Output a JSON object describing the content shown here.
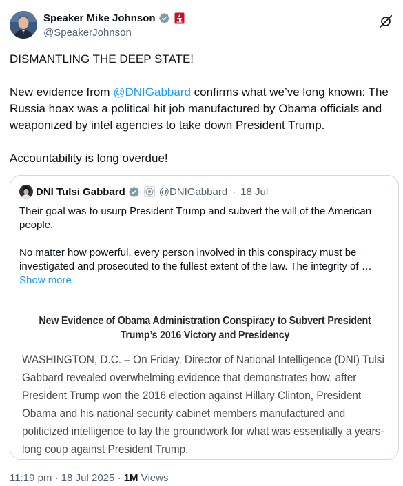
{
  "author": {
    "name": "Speaker Mike Johnson",
    "handle": "@SpeakerJohnson"
  },
  "tweet": {
    "line1": "DISMANTLING THE DEEP STATE!",
    "para2_before": "New evidence from ",
    "para2_mention": "@DNIGabbard",
    "para2_after": " confirms what we’ve long known: The Russia hoax was a political hit job manufactured by Obama officials and weaponized by intel agencies to take down President Trump.",
    "para3": "Accountability is long overdue!"
  },
  "quote": {
    "name": "DNI Tulsi Gabbard",
    "handle": "@DNIGabbard",
    "separator": "·",
    "date": "18 Jul",
    "para1": "Their goal was to usurp President Trump and subvert the will of the American people.",
    "para2": "No matter how powerful, every person involved in this conspiracy must be investigated and prosecuted to the fullest extent of the law. The integrity of …",
    "show_more": "Show more",
    "image": {
      "title": "New Evidence of Obama Administration Conspiracy to Subvert President Trump’s 2016 Victory and Presidency",
      "body": "WASHINGTON, D.C. – On Friday, Director of National Intelligence (DNI) Tulsi Gabbard revealed overwhelming evidence that demonstrates how, after President Trump won the 2016 election against Hillary Clinton, President Obama and his national security cabinet members manufactured and politicized intelligence to lay the groundwork for what was essentially a years-long coup against President Trump."
    }
  },
  "footer": {
    "time": "11:19 pm",
    "separator": "·",
    "date": "18 Jul 2025",
    "views_count": "1M",
    "views_label": "Views"
  },
  "colors": {
    "link": "#1d9bf0",
    "verified_grey": "#829aab",
    "secondary_text": "#536471",
    "affiliate_badge": "#c8102e"
  },
  "icons": [
    "verified-badge-icon",
    "affiliate-badge-icon",
    "grok-icon",
    "government-seal-icon"
  ]
}
